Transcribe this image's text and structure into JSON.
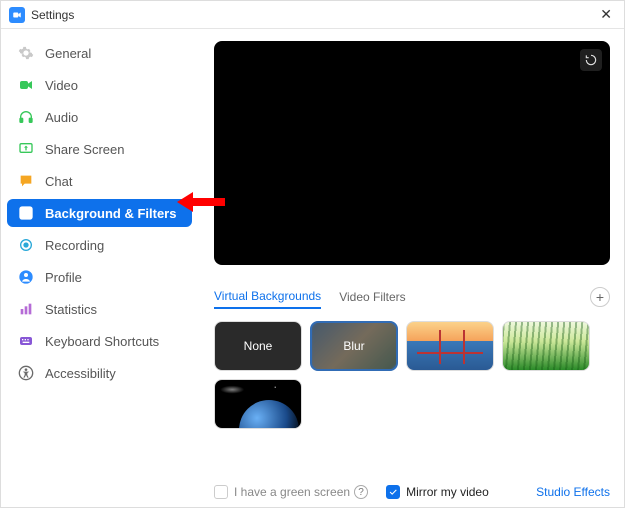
{
  "window": {
    "title": "Settings"
  },
  "sidebar": {
    "items": [
      {
        "label": "General"
      },
      {
        "label": "Video"
      },
      {
        "label": "Audio"
      },
      {
        "label": "Share Screen"
      },
      {
        "label": "Chat"
      },
      {
        "label": "Background & Filters"
      },
      {
        "label": "Recording"
      },
      {
        "label": "Profile"
      },
      {
        "label": "Statistics"
      },
      {
        "label": "Keyboard Shortcuts"
      },
      {
        "label": "Accessibility"
      }
    ]
  },
  "tabs": {
    "virtual_backgrounds": "Virtual Backgrounds",
    "video_filters": "Video Filters"
  },
  "thumbs": {
    "none": "None",
    "blur": "Blur"
  },
  "footer": {
    "green_screen": "I have a green screen",
    "mirror": "Mirror my video",
    "studio_effects": "Studio Effects"
  }
}
